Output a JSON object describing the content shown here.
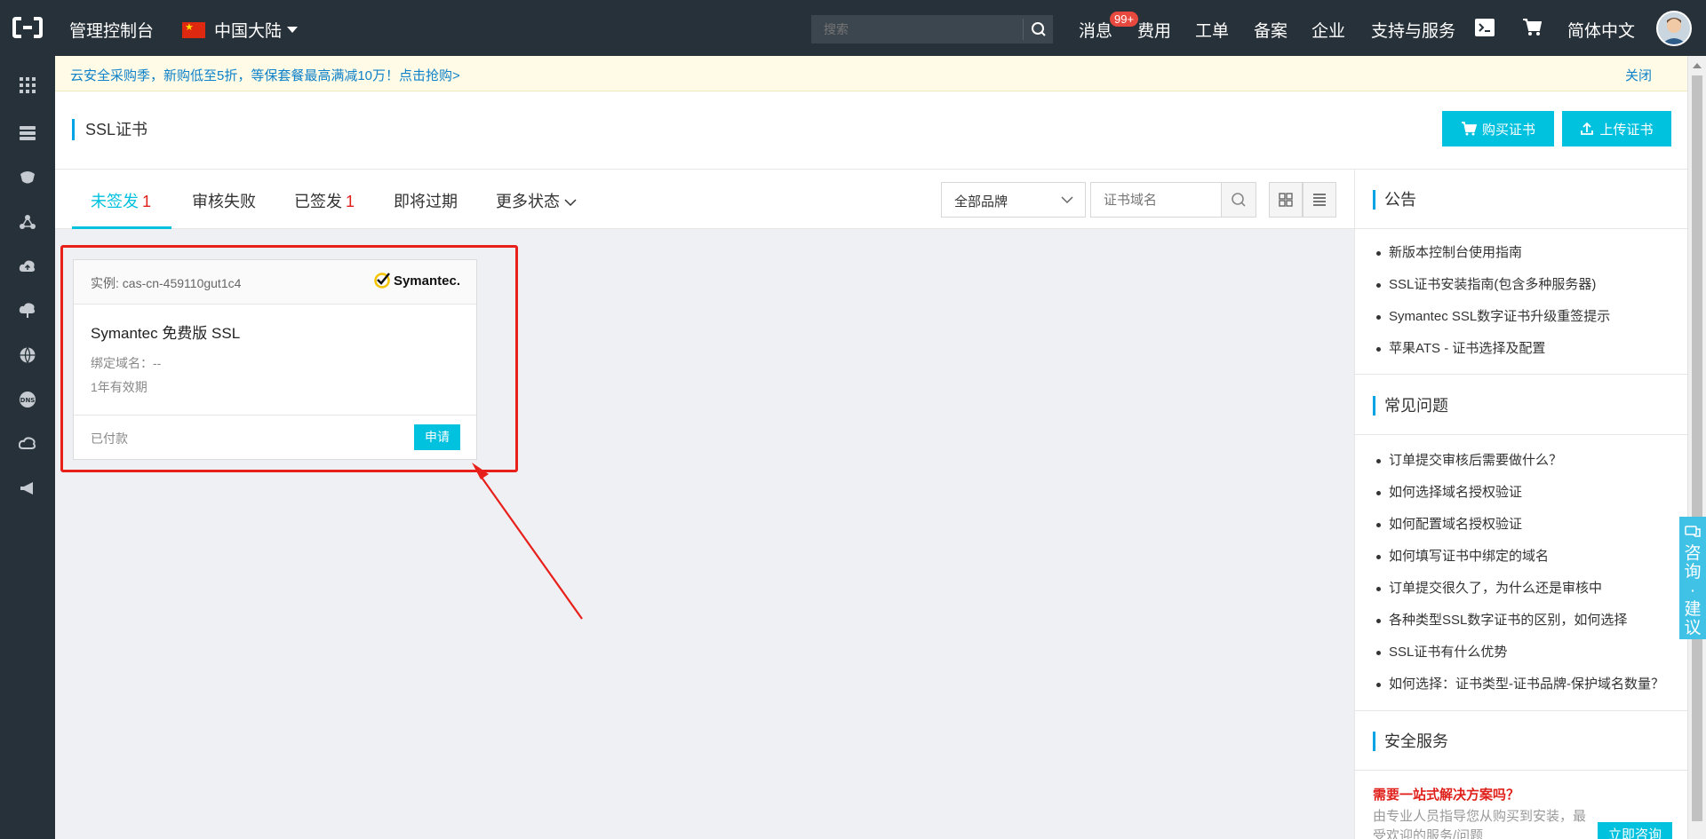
{
  "topbar": {
    "brand": "管理控制台",
    "region": "中国大陆",
    "search_placeholder": "搜索",
    "nav": {
      "messages": "消息",
      "messages_badge": "99+",
      "billing": "费用",
      "tickets": "工单",
      "icp": "备案",
      "enterprise": "企业",
      "support": "支持与服务",
      "language": "简体中文"
    }
  },
  "sidebar": {
    "icons": [
      "grid-icon",
      "server-icon",
      "cloud-db-icon",
      "network-icon",
      "cloud-upload-icon",
      "cloud-download-icon",
      "globe-icon",
      "dns-icon",
      "cloud-icon",
      "megaphone-icon"
    ]
  },
  "notice": {
    "text": "云安全采购季，新购低至5折，等保套餐最高满减10万！点击抢购>",
    "close": "关闭"
  },
  "header": {
    "title": "SSL证书",
    "buy_button": "购买证书",
    "upload_button": "上传证书"
  },
  "tabs": [
    {
      "label": "未签发",
      "count": "1"
    },
    {
      "label": "审核失败",
      "count": ""
    },
    {
      "label": "已签发",
      "count": "1"
    },
    {
      "label": "即将过期",
      "count": ""
    },
    {
      "label": "更多状态",
      "count": ""
    }
  ],
  "filters": {
    "brand_select": "全部品牌",
    "domain_placeholder": "证书域名"
  },
  "card": {
    "instance": "实例: cas-cn-459110gut1c4",
    "brand_logo": "Symantec.",
    "name": "Symantec 免费版 SSL",
    "domain": "绑定域名：--",
    "validity": "1年有效期",
    "status": "已付款",
    "apply_button": "申请"
  },
  "right_panel": {
    "announce_title": "公告",
    "announcements": [
      "新版本控制台使用指南",
      "SSL证书安装指南(包含多种服务器)",
      "Symantec SSL数字证书升级重签提示",
      "苹果ATS - 证书选择及配置"
    ],
    "faq_title": "常见问题",
    "faqs": [
      "订单提交审核后需要做什么？",
      "如何选择域名授权验证",
      "如何配置域名授权验证",
      "如何填写证书中绑定的域名",
      "订单提交很久了，为什么还是审核中",
      "各种类型SSL数字证书的区别，如何选择",
      "SSL证书有什么优势",
      "如何选择：证书类型-证书品牌-保护域名数量？"
    ],
    "security_title": "安全服务",
    "security_headline": "需要一站式解决方案吗？",
    "security_desc": "由专业人员指导您从购买到安装，最受欢迎的服务/问题",
    "consult_button": "立即咨询"
  },
  "float_consult": "咨询·建议",
  "colors": {
    "topbar": "#273139",
    "accent": "#00c1de",
    "highlight": "#e8201b",
    "count_red": "#e0211b"
  }
}
